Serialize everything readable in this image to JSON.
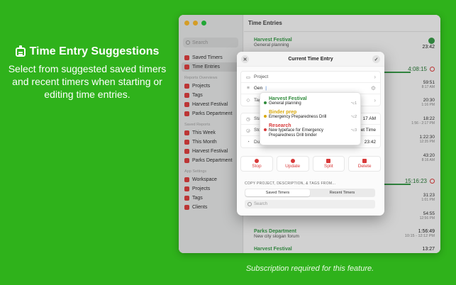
{
  "promo": {
    "title": "Time Entry Suggestions",
    "subtitle": "Select from suggested saved timers and recent timers when starting or editing time entries.",
    "footer": "Subscription required for this feature."
  },
  "window": {
    "traffic_lights": [
      "#fdbc2e",
      "#fdbc2e",
      "#28c840"
    ],
    "search_placeholder": "Search",
    "nav": [
      {
        "label": "Saved Timers",
        "selected": false
      },
      {
        "label": "Time Entries",
        "selected": true
      }
    ],
    "sections": {
      "overviews": "Reports Overviews",
      "saved_reports": "Saved Reports",
      "app_settings": "App Settings"
    },
    "overview_items": [
      "Projects",
      "Tags",
      "Harvest Festival",
      "Parks Department"
    ],
    "saved_report_items": [
      "This Week",
      "This Month",
      "Harvest Festival",
      "Parks Department"
    ],
    "settings_items": [
      "Workspace",
      "Projects",
      "Tags",
      "Clients"
    ],
    "main_title": "Time Entries",
    "running_entry": {
      "project": "Harvest Festival",
      "description": "General planning",
      "time": "23:42"
    },
    "day1_total": "4:08:15",
    "day2_total": "15:16:23",
    "right_times": [
      {
        "time": "59:51",
        "range": "8:17 AM"
      },
      {
        "time": "20:30",
        "range": "1:16 PM"
      },
      {
        "time": "18:22",
        "range": "1:56 - 2:17 PM"
      },
      {
        "time": "1:22:30",
        "range": "12:35 PM"
      },
      {
        "time": "43:20",
        "range": "8:16 AM"
      },
      {
        "time": "31:23",
        "range": "1:01 PM"
      },
      {
        "time": "54:55",
        "range": "12:56 PM"
      }
    ],
    "bottom_entries": [
      {
        "project": "Parks Department",
        "description": "New city slogan forum",
        "time": "1:56:49",
        "range": "10:15 - 12:12 PM"
      },
      {
        "project": "Harvest Festival",
        "description": "",
        "time": "13:27",
        "range": ""
      }
    ],
    "peek_texts": {
      "start": "17 AM",
      "stop": "et Time",
      "duration": "23:42"
    }
  },
  "sheet": {
    "title": "Current Time Entry",
    "project_placeholder": "Project",
    "description_value": "Gen",
    "tags_label": "Tag",
    "start_label": "Sta",
    "stop_label": "Sto",
    "duration_label": "Dur",
    "actions": [
      "Stop",
      "Update",
      "Split",
      "Delete"
    ],
    "copy_header": "COPY PROJECT, DESCRIPTION, & TAGS FROM...",
    "tabs": [
      "Saved Timers",
      "Recent Timers"
    ],
    "search_placeholder": "Search"
  },
  "suggestions": [
    {
      "project": "Harvest Festival",
      "description": "General planning",
      "shortcut": "⌥1",
      "color": "#2e8b3a"
    },
    {
      "project": "Binder prep",
      "description": "Emergency Preparedness Drill",
      "shortcut": "⌥2",
      "color": "#d9a90d"
    },
    {
      "project": "Research",
      "description": "New typeface for Emergency Preparedness Drill binder",
      "shortcut": "⌥3",
      "color": "#d83a3a"
    }
  ]
}
